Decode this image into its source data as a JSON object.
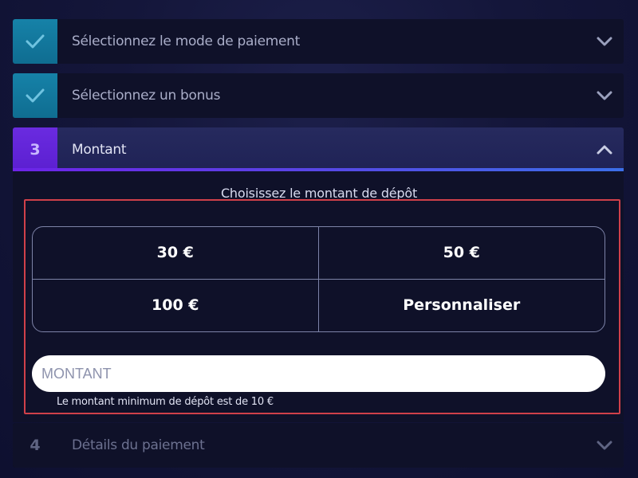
{
  "steps": [
    {
      "number": "",
      "label": "Sélectionnez le mode de paiement",
      "status": "done",
      "icon": "checkmark-icon",
      "chevron": "chevron-down-icon"
    },
    {
      "number": "",
      "label": "Sélectionnez un bonus",
      "status": "done",
      "icon": "checkmark-icon",
      "chevron": "chevron-down-icon"
    },
    {
      "number": "3",
      "label": "Montant",
      "status": "active",
      "chevron": "chevron-up-icon"
    },
    {
      "number": "4",
      "label": "Détails du paiement",
      "status": "pending",
      "chevron": "chevron-down-icon"
    }
  ],
  "amount_section": {
    "title": "Choisissez le montant de dépôt",
    "options": [
      "30 €",
      "50 €",
      "100 €",
      "Personnaliser"
    ],
    "input": {
      "placeholder": "MONTANT",
      "value": ""
    },
    "min_note": "Le montant minimum de dépôt est de 10 €"
  },
  "colors": {
    "done_accent": "#1682a8",
    "active_accent": "#6a2be0",
    "focus_outline": "#d0404a",
    "background": "#14163a"
  }
}
